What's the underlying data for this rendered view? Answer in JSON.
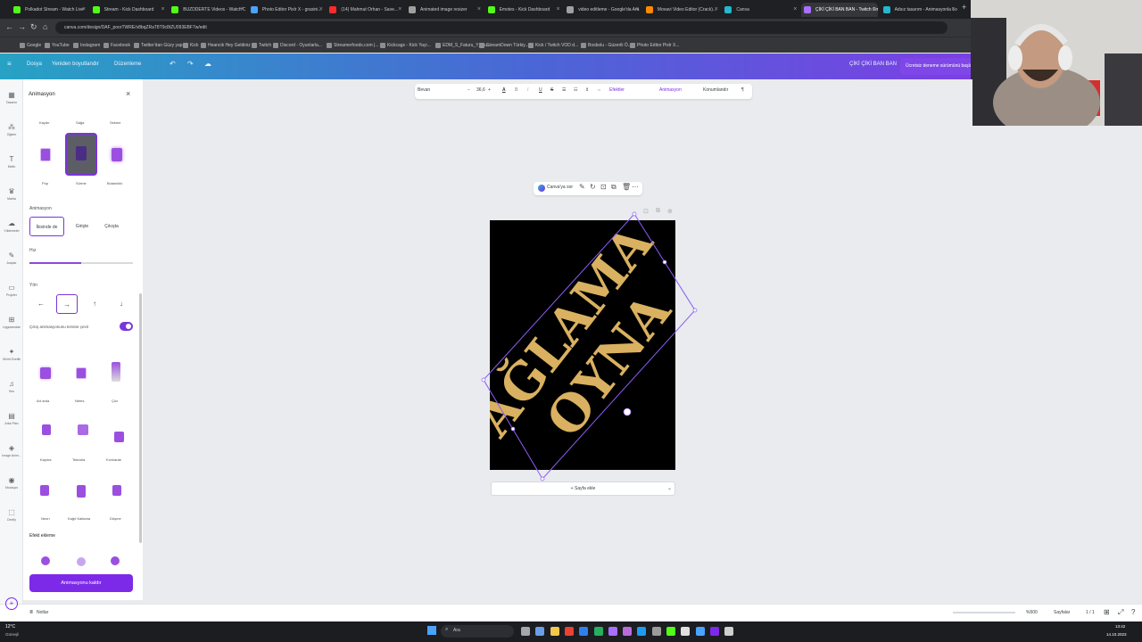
{
  "browser": {
    "tabs": [
      {
        "label": "Polkadot Stream - Watch Live",
        "color": "#53fc18"
      },
      {
        "label": "Stream - Kick Dashboard",
        "color": "#53fc18"
      },
      {
        "label": "BUZDDERTE Videos - Watch O...",
        "color": "#53fc18"
      },
      {
        "label": "Photo Editor Pixlr X - grasini...",
        "color": "#4aa3ff"
      },
      {
        "label": "(14) Mahmut Orhan - Save...",
        "color": "#ff2b2b"
      },
      {
        "label": "Animated image resizer",
        "color": "#a0a0a0"
      },
      {
        "label": "Emotes - Kick Dashboard",
        "color": "#53fc18"
      },
      {
        "label": "video editleme - Google'da Ara",
        "color": "#a0a0a0"
      },
      {
        "label": "Movavi Video Editor (Crack)...",
        "color": "#ff8a00"
      },
      {
        "label": "Canva",
        "color": "#22b8cf"
      },
      {
        "label": "ÇİKİ ÇİKİ BAN BAN - Twitch Em...",
        "color": "#a970ff"
      },
      {
        "label": "Adsız tasarım - Animasyonla Lo...",
        "color": "#22b8cf"
      }
    ],
    "url": "canva.com/design/DAF_poorTWRE/v8bqZRaT8T9c8tZU093EBF7w/edit",
    "bookmarks": [
      "Google",
      "YouTube",
      "Instagram",
      "Facebook",
      "Twitter'dan Güzy yap",
      "Kick",
      "Heancik Hey Geldiniz",
      "Twitch",
      "Discord - Oyunlarla...",
      "Streamerfoods.com |...",
      "Kickcags - Kick Yayi...",
      "EDM_S_Faturu_Y_Gu...",
      "StreamDown Türkiy...",
      "Kick / Twitch VOD d...",
      "Bosbolu - Güzerili Ö...",
      "Photo Editor Pixlr X..."
    ]
  },
  "canva_header": {
    "file": "Dosya",
    "resize": "Yeniden boyutlandır",
    "edit": "Düzenleme",
    "project_title": "ÇİKİ ÇİKİ BAN BAN",
    "promo": "Ücretsiz deneme sürümünü başlat"
  },
  "rail": [
    "Tasarım",
    "Öğeler",
    "Metin",
    "Marka",
    "Yüklemeler",
    "Araçlar",
    "Projeler",
    "Uygulamalar",
    "Sihirli Özellik",
    "Ses",
    "Arka Plan",
    "Image Anim...",
    "Mockups",
    "Dexify"
  ],
  "panel": {
    "title": "Animasyon",
    "prev_labels": [
      "Kaydır",
      "Sağa",
      "Sekme"
    ],
    "row1_labels": [
      "Pop",
      "Sürme",
      "Bulanıklık"
    ],
    "animasyon_label": "Animasyon",
    "tabs": [
      "İkisinde de",
      "Girişte",
      "Çıkışta"
    ],
    "hiz_label": "Hız",
    "speed": 0.5,
    "yon_label": "Yön",
    "directions": [
      "←",
      "→",
      "↑",
      "↓"
    ],
    "reverse_label": "Çıkış animasyonunu tersine çevir",
    "row2_labels": [
      "Art arda",
      "Nefes",
      "Çöz"
    ],
    "row3_labels": [
      "Kayma",
      "Tekrarla",
      "Kıvrılarak"
    ],
    "row4_labels": [
      "Neon",
      "Kağıt Katlama",
      "Düşme"
    ],
    "effect_label": "Efekt ekleme",
    "remove_button": "Animasyonu kaldır"
  },
  "toolbar": {
    "font": "Bevan",
    "size": "36,6",
    "effects": "Efektler",
    "animate": "Animasyon",
    "position": "Konumlandır"
  },
  "floatbar": {
    "ask": "Canva'ya sor"
  },
  "design": {
    "line1": "AĞLAMA",
    "line2": "OYNA",
    "text_color": "#d9b160",
    "background": "#000000"
  },
  "add_page": "+ Sayfa ekle",
  "bottom": {
    "notes": "Notlar",
    "zoom": "%500",
    "pages": "Sayfalar",
    "page_count": "1 / 1"
  },
  "taskbar": {
    "weather": "12°C",
    "weather_desc": "Güneşli",
    "search": "Ara",
    "time": "13:42",
    "date": "14.10.2023"
  }
}
